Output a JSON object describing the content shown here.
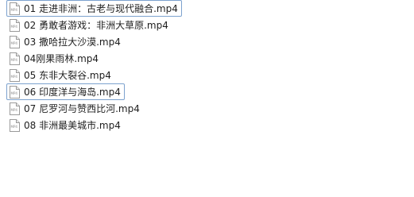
{
  "files": [
    {
      "label": "01 走进非洲：古老与现代融合.mp4",
      "icon": "mp4-file-icon",
      "selected": true
    },
    {
      "label": "02 勇敢者游戏：非洲大草原.mp4",
      "icon": "mp4-file-icon",
      "selected": false
    },
    {
      "label": "03 撒哈拉大沙漠.mp4",
      "icon": "mp4-file-icon",
      "selected": false
    },
    {
      "label": "04刚果雨林.mp4",
      "icon": "mp4-file-icon",
      "selected": false
    },
    {
      "label": "05 东非大裂谷.mp4",
      "icon": "mp4-file-icon",
      "selected": false
    },
    {
      "label": "06 印度洋与海岛.mp4",
      "icon": "mp4-file-icon",
      "selected": true
    },
    {
      "label": "07 尼罗河与赞西比河.mp4",
      "icon": "mp4-file-icon",
      "selected": false
    },
    {
      "label": "08 非洲最美城市.mp4",
      "icon": "mp4-file-icon",
      "selected": false
    }
  ],
  "icon_text": "MP4",
  "colors": {
    "selection_border": "#7da2ce",
    "icon_outline": "#9a9a9a",
    "icon_text": "#8a8a8a"
  }
}
